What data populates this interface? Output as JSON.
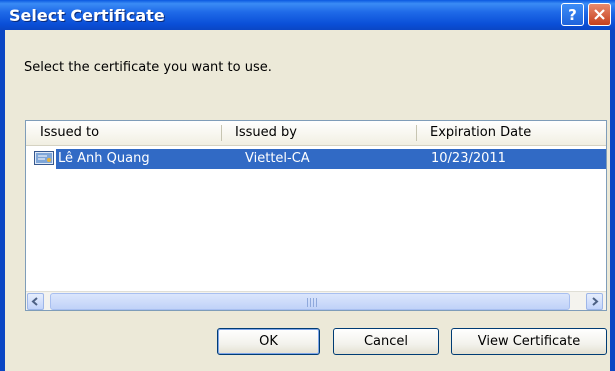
{
  "window": {
    "title": "Select Certificate",
    "help_icon": "question-mark-icon",
    "close_icon": "close-x-icon"
  },
  "prompt": "Select the certificate you want to use.",
  "list": {
    "columns": [
      "Issued to",
      "Issued by",
      "Expiration Date"
    ],
    "rows": [
      {
        "icon": "certificate-icon",
        "issued_to": "Lê Anh Quang",
        "issued_by": "Viettel-CA",
        "expiration": "10/23/2011",
        "selected": true
      }
    ]
  },
  "buttons": {
    "ok": "OK",
    "cancel": "Cancel",
    "view": "View Certificate"
  },
  "colors": {
    "title_bar": "#0a50d8",
    "selection": "#316ac5",
    "dialog_bg": "#ece9d8",
    "close_button": "#c6401d"
  }
}
